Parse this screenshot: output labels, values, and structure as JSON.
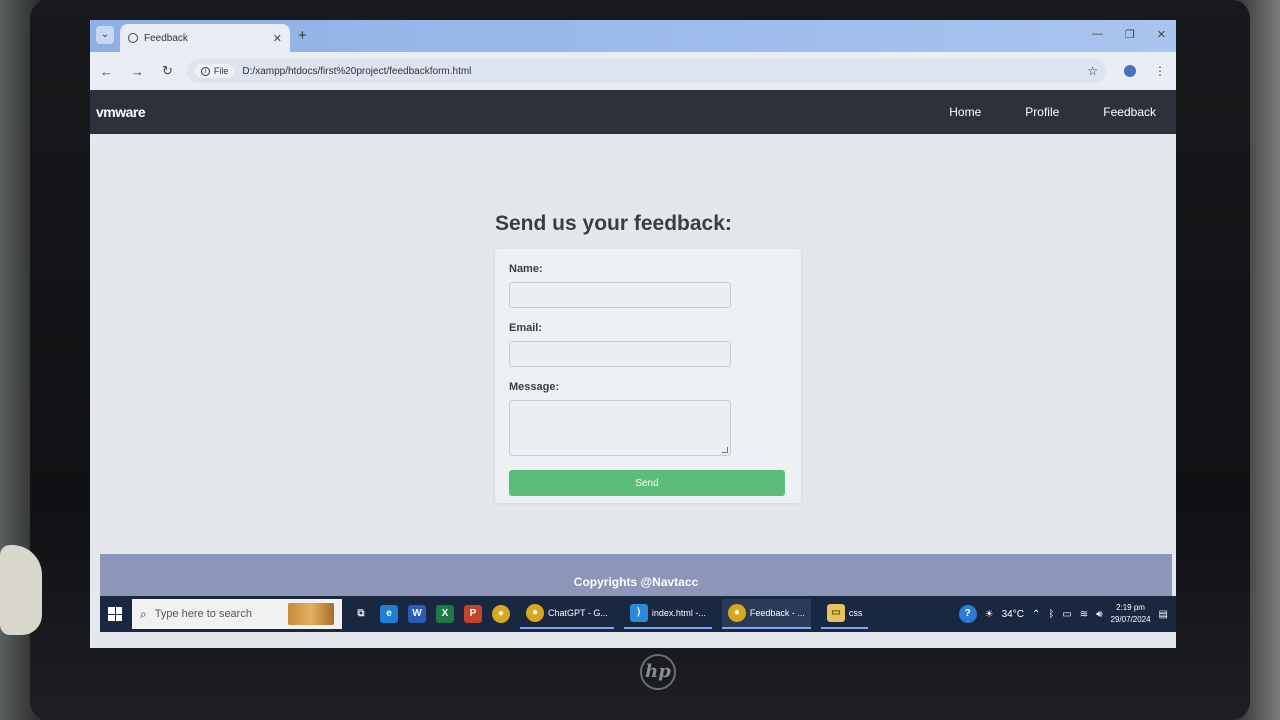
{
  "browser": {
    "tab_title": "Feedback",
    "new_tab": "+",
    "file_chip": "File",
    "url": "D:/xampp/htdocs/first%20project/feedbackform.html",
    "window_controls": [
      "—",
      "❐",
      "✕"
    ]
  },
  "site": {
    "logo": "vmware",
    "nav": {
      "home": "Home",
      "profile": "Profile",
      "feedback": "Feedback"
    }
  },
  "form": {
    "heading": "Send us your feedback:",
    "name_label": "Name:",
    "name_value": "",
    "email_label": "Email:",
    "email_value": "",
    "message_label": "Message:",
    "message_value": "",
    "send_label": "Send"
  },
  "footer": {
    "text": "Copyrights @Navtacc"
  },
  "taskbar": {
    "search_placeholder": "Type here to search",
    "apps": [
      {
        "label": "ChatGPT - G..."
      },
      {
        "label": "index.html -..."
      },
      {
        "label": "Feedback - ..."
      },
      {
        "label": "css"
      }
    ],
    "weather": "34°C",
    "time": "2:19 pm",
    "date": "29/07/2024"
  },
  "colors": {
    "nav_bg": "#2c313c",
    "send_bg": "#5cbd7a",
    "footer_bg": "#8d95b8",
    "taskbar_bg": "#1a2740"
  }
}
